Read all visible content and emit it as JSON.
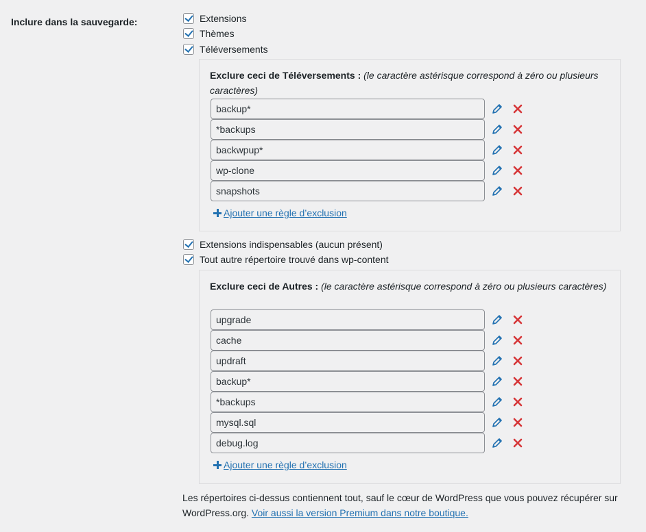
{
  "setting": {
    "label": "Inclure dans la sauvegarde:"
  },
  "checkboxes": [
    {
      "label": "Extensions",
      "checked": true
    },
    {
      "label": "Thèmes",
      "checked": true
    },
    {
      "label": "Téléversements",
      "checked": true
    },
    {
      "label": "Extensions indispensables (aucun présent)",
      "checked": true
    },
    {
      "label": "Tout autre répertoire trouvé dans wp-content",
      "checked": true
    }
  ],
  "uploads_exclude": {
    "title": "Exclure ceci de Téléversements :",
    "hint": "(le caractère astérisque correspond à zéro ou plusieurs caractères)",
    "rules": [
      "backup*",
      "*backups",
      "backwpup*",
      "wp-clone",
      "snapshots"
    ],
    "add_label": "Ajouter une règle d’exclusion"
  },
  "others_exclude": {
    "title": "Exclure ceci de Autres :",
    "hint": "(le caractère astérisque correspond à zéro ou plusieurs caractères)",
    "rules": [
      "upgrade",
      "cache",
      "updraft",
      "backup*",
      "*backups",
      "mysql.sql",
      "debug.log"
    ],
    "add_label": "Ajouter une règle d’exclusion"
  },
  "footer": {
    "text": "Les répertoires ci-dessus contiennent tout, sauf le cœur de WordPress que vous pouvez récupérer sur WordPress.org.",
    "link": "Voir aussi la version Premium dans notre boutique."
  },
  "colors": {
    "accent": "#2271b1",
    "delete": "#d63638",
    "background": "#f0f0f1"
  },
  "icons": {
    "edit": "pencil-icon",
    "delete": "cross-icon",
    "add": "plus-icon",
    "checkbox": "checkmark-icon"
  }
}
